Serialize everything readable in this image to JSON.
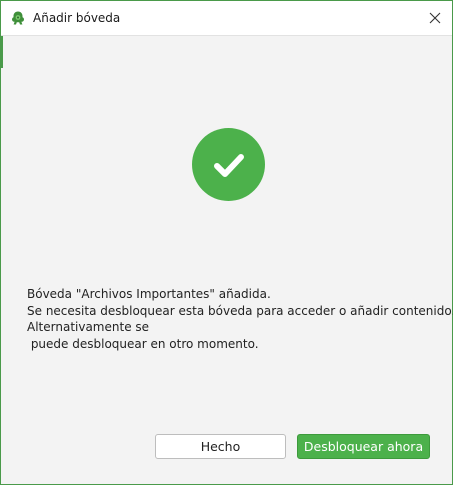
{
  "window": {
    "title": "Añadir bóveda",
    "icon": "app-vault-icon",
    "close_icon": "close-icon"
  },
  "status": {
    "icon": "checkmark-icon",
    "color": "#4cb14b"
  },
  "message": {
    "lines": [
      "Bóveda \"Archivos Importantes\" añadida.",
      "Se necesita desbloquear esta bóveda para acceder o añadir contenido.",
      "Alternativamente se",
      " puede desbloquear en otro momento."
    ]
  },
  "buttons": {
    "done_label": "Hecho",
    "unlock_label": "Desbloquear ahora"
  },
  "colors": {
    "accent": "#4cb14b",
    "border": "#4a9a4a"
  }
}
